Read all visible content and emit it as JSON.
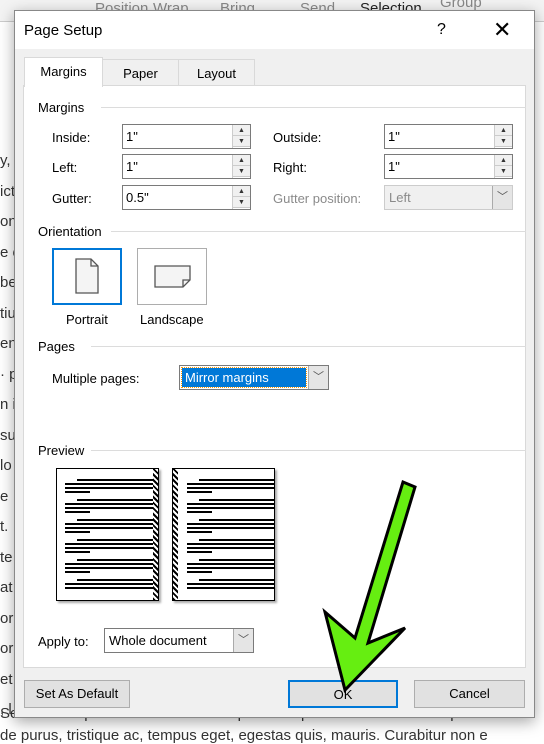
{
  "background": {
    "ribbon": [
      "Position",
      "Wrap",
      "Bring",
      "Send",
      "Selection",
      "Group"
    ],
    "doc_lines_left": [
      "y, l",
      "icte",
      "on",
      "e e",
      "be",
      "tiu",
      "en",
      "· p",
      "n i",
      "su",
      "lo",
      "e",
      "t.",
      "te",
      "at",
      "or",
      "or",
      "et",
      ", l"
    ],
    "doc_bottom": [
      "Sed cursus quam id felis. Curabitur posuere quam vel nibh. Cras dapibus do",
      "de purus, tristique ac, tempus eget, egestas quis, mauris. Curabitur non e"
    ]
  },
  "dialog": {
    "title": "Page Setup",
    "help": "?",
    "close": "✕",
    "tabs": [
      {
        "label": "Margins",
        "active": true
      },
      {
        "label": "Paper"
      },
      {
        "label": "Layout"
      }
    ],
    "margins": {
      "heading": "Margins",
      "inside": {
        "label": "Inside:",
        "value": "1\""
      },
      "outside": {
        "label": "Outside:",
        "value": "1\""
      },
      "left": {
        "label": "Left:",
        "value": "1\""
      },
      "right": {
        "label": "Right:",
        "value": "1\""
      },
      "gutter": {
        "label": "Gutter:",
        "value": "0.5\""
      },
      "gutter_position": {
        "label": "Gutter position:",
        "value": "Left",
        "disabled": true
      }
    },
    "orientation": {
      "heading": "Orientation",
      "portrait": "Portrait",
      "landscape": "Landscape",
      "selected": "Portrait"
    },
    "pages": {
      "heading": "Pages",
      "multiple_label": "Multiple pages:",
      "multiple_value": "Mirror margins"
    },
    "preview": {
      "heading": "Preview"
    },
    "apply": {
      "label": "Apply to:",
      "value": "Whole document"
    },
    "buttons": {
      "set_default": "Set As Default",
      "ok": "OK",
      "cancel": "Cancel"
    }
  },
  "colors": {
    "accent": "#0078d7",
    "arrow": "#66ee11"
  },
  "icons": {
    "arrow": "green-arrow-pointing-to-ok"
  }
}
